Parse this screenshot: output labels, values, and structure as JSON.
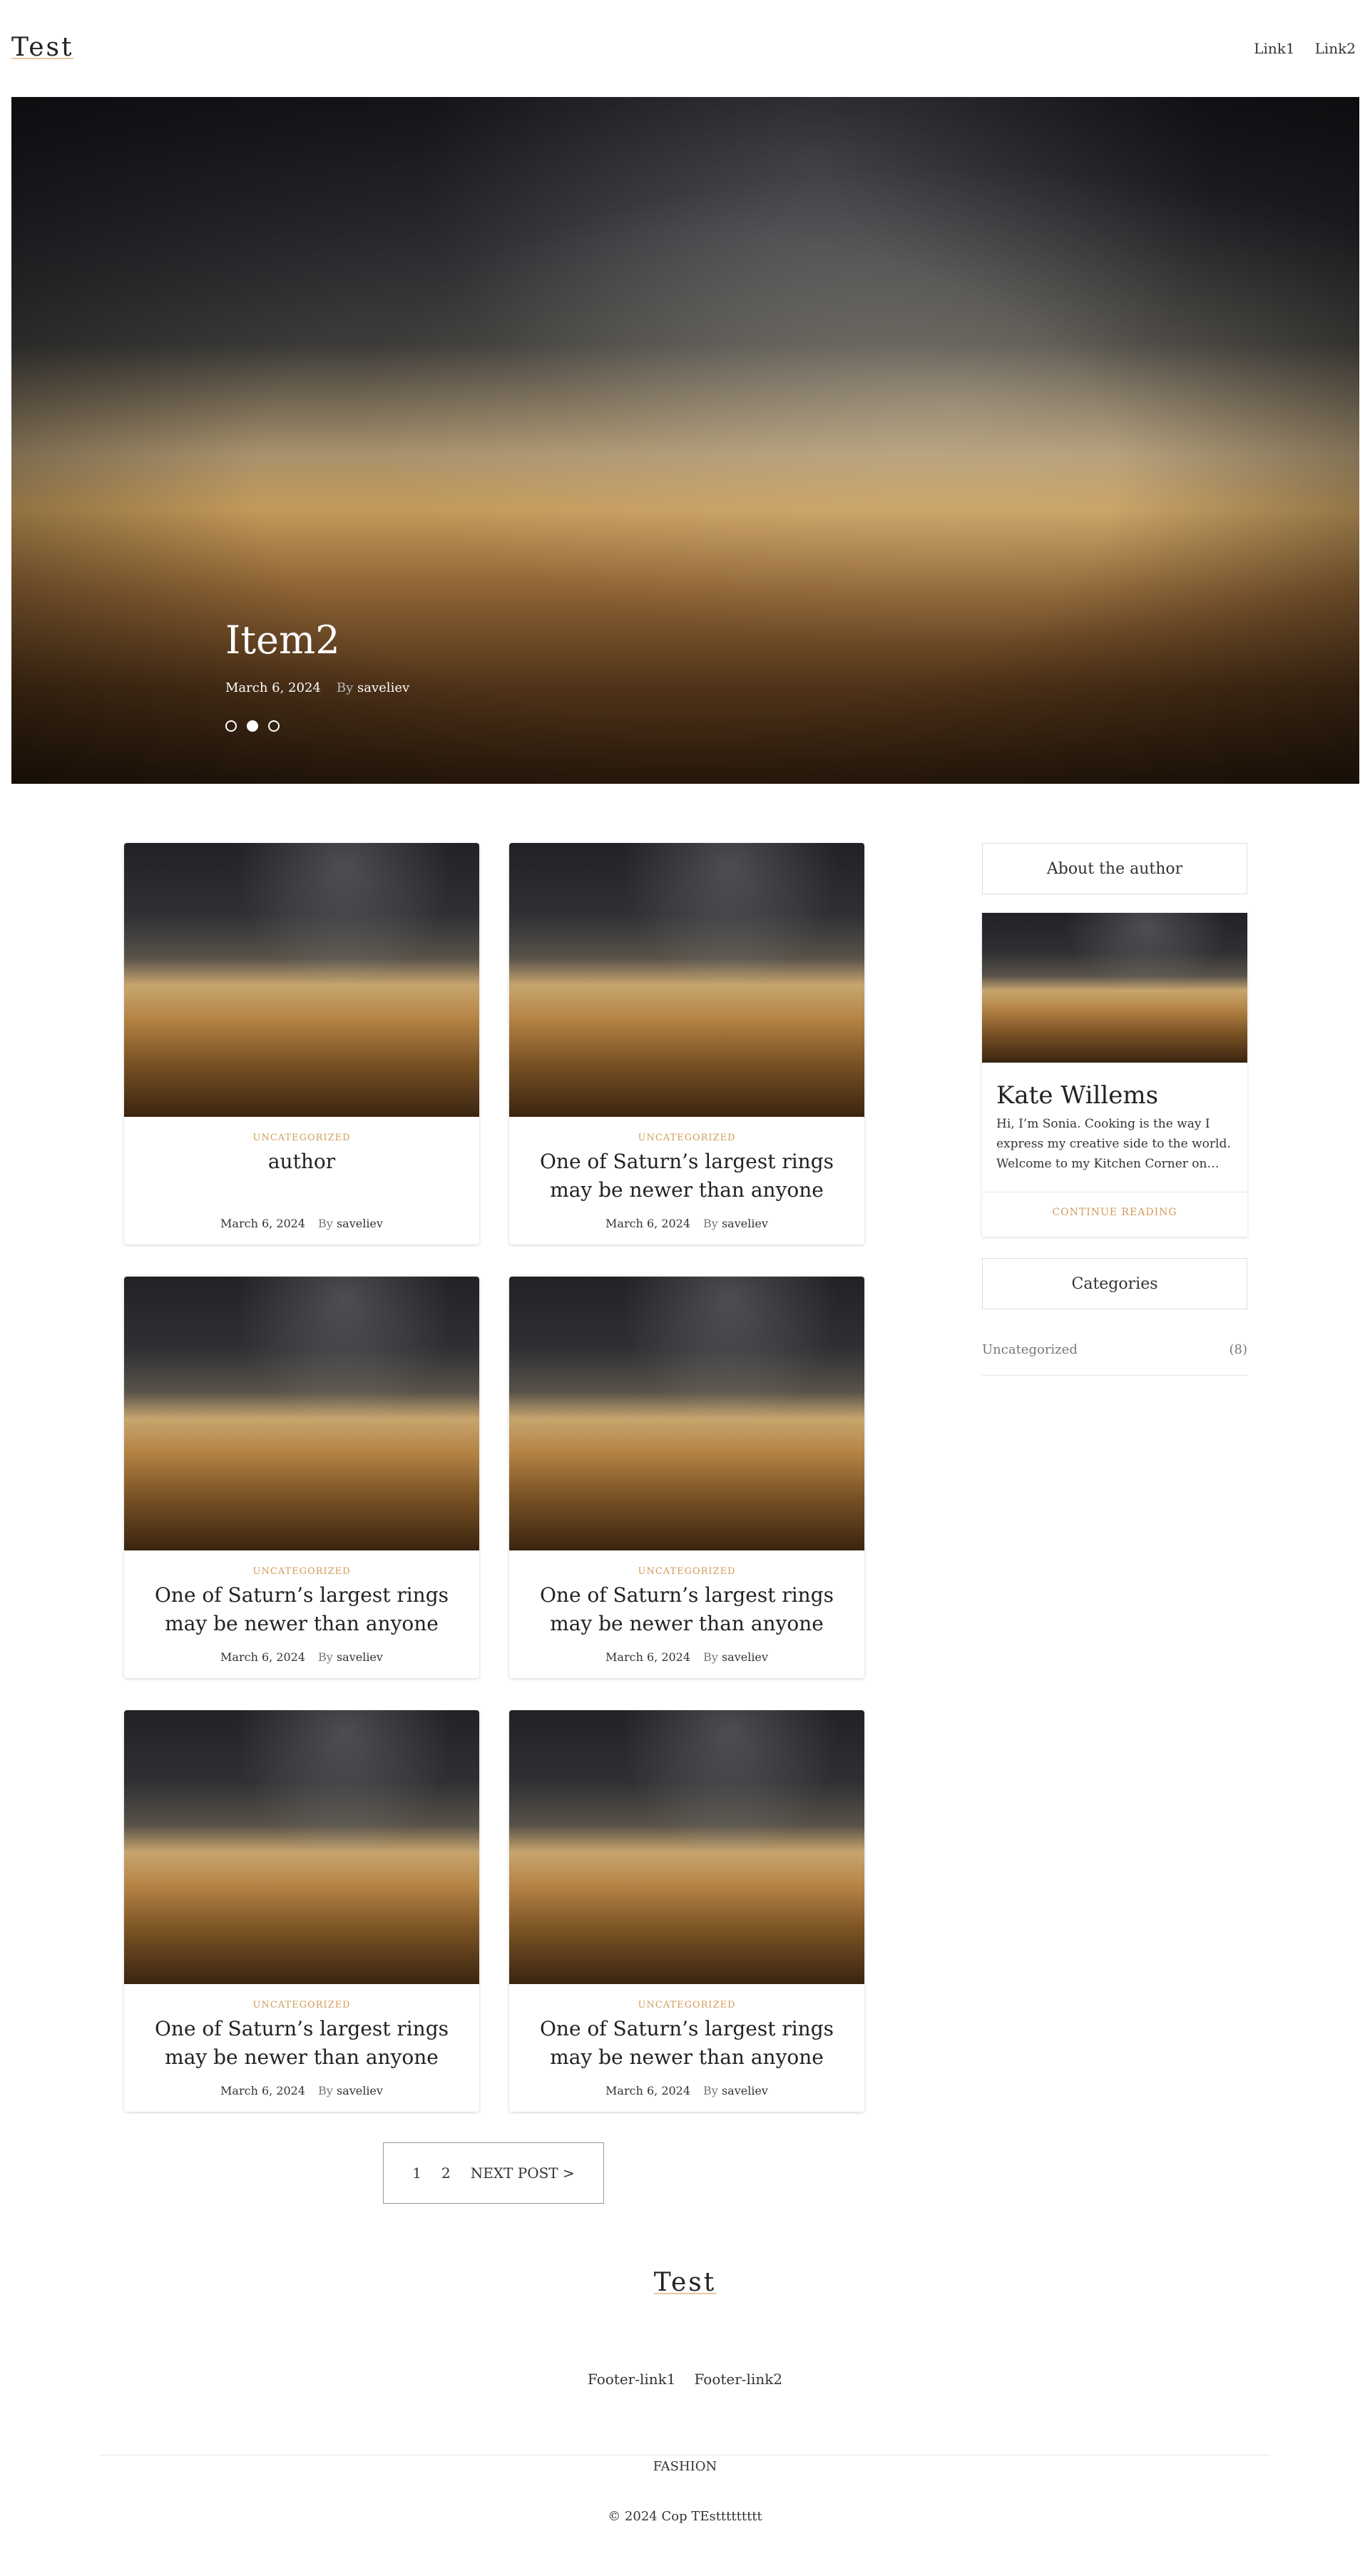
{
  "header": {
    "logo": "Test",
    "nav": [
      "Link1",
      "Link2"
    ]
  },
  "hero": {
    "title": "Item2",
    "date": "March 6, 2024",
    "by": "By",
    "author": "saveliev",
    "dots_total": 3,
    "active_dot": 2
  },
  "posts": [
    {
      "category": "UNCATEGORIZED",
      "title": "author",
      "date": "March 6, 2024",
      "by": "By",
      "author": "saveliev"
    },
    {
      "category": "UNCATEGORIZED",
      "title": "One of Saturn’s largest rings may be newer than anyone",
      "date": "March 6, 2024",
      "by": "By",
      "author": "saveliev"
    },
    {
      "category": "UNCATEGORIZED",
      "title": "One of Saturn’s largest rings may be newer than anyone",
      "date": "March 6, 2024",
      "by": "By",
      "author": "saveliev"
    },
    {
      "category": "UNCATEGORIZED",
      "title": "One of Saturn’s largest rings may be newer than anyone",
      "date": "March 6, 2024",
      "by": "By",
      "author": "saveliev"
    },
    {
      "category": "UNCATEGORIZED",
      "title": "One of Saturn’s largest rings may be newer than anyone",
      "date": "March 6, 2024",
      "by": "By",
      "author": "saveliev"
    },
    {
      "category": "UNCATEGORIZED",
      "title": "One of Saturn’s largest rings may be newer than anyone",
      "date": "March 6, 2024",
      "by": "By",
      "author": "saveliev"
    }
  ],
  "pagination": {
    "pages": [
      "1",
      "2"
    ],
    "next": "NEXT POST >"
  },
  "sidebar": {
    "about_heading": "About the author",
    "author_name": "Kate Willems",
    "author_bio": "Hi, I’m Sonia. Cooking is the way I express my creative side to the world. Welcome to my Kitchen Corner on…",
    "continue_reading": "CONTINUE READING",
    "categories_heading": "Categories",
    "categories": [
      {
        "name": "Uncategorized",
        "count": "(8)"
      }
    ]
  },
  "footer": {
    "logo": "Test",
    "links": [
      "Footer-link1",
      "Footer-link2"
    ],
    "category": "FASHION",
    "copyright": "© 2024 Cop TEsttttttttt"
  },
  "colors": {
    "accent": "#d19b5a",
    "text": "#222222"
  }
}
